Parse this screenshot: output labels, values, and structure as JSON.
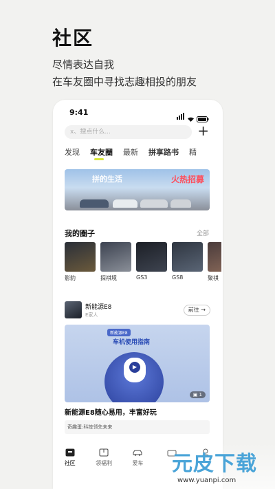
{
  "hero": {
    "title": "社区",
    "subtitle_line1": "尽情表达自我",
    "subtitle_line2": "在车友圈中寻找志趣相投的朋友"
  },
  "status_bar": {
    "time": "9:41"
  },
  "search": {
    "placeholder": "x、搜点什么..."
  },
  "tabs": [
    {
      "label": "发现",
      "active": false
    },
    {
      "label": "车友圈",
      "active": true
    },
    {
      "label": "最新",
      "active": false
    },
    {
      "label": "拼享路书",
      "active": false
    },
    {
      "label": "精",
      "active": false
    }
  ],
  "banner": {
    "line1": "拼的生活",
    "line2": "火热招募"
  },
  "my_circles": {
    "title": "我的圈子",
    "more": "全部",
    "items": [
      {
        "label": "影豹"
      },
      {
        "label": "探祺境"
      },
      {
        "label": "GS3"
      },
      {
        "label": "GS8"
      },
      {
        "label": "聚祺"
      }
    ]
  },
  "post": {
    "circle_name": "新能源E8",
    "members": "E家人",
    "goto_label": "前往 →",
    "image_tag": "新能源E8",
    "image_title": "车机使用指南",
    "image_count": "1",
    "caption": "新能源E8随心易用，丰富好玩",
    "quote": "奇趣蛋:科技领先未来"
  },
  "bottom_nav": [
    {
      "label": "社区",
      "icon": "community-icon",
      "active": true
    },
    {
      "label": "领福利",
      "icon": "gift-icon",
      "active": false
    },
    {
      "label": "爱车",
      "icon": "car-icon",
      "active": false
    },
    {
      "label": "",
      "icon": "shop-icon",
      "active": false
    },
    {
      "label": "",
      "icon": "profile-icon",
      "active": false
    }
  ],
  "watermark": {
    "title": "元皮下载",
    "url": "www.yuanpi.com"
  },
  "colors": {
    "accent": "#d8e63a",
    "banner_red": "#ff4d5a",
    "guide_blue": "#2a4bb5"
  }
}
